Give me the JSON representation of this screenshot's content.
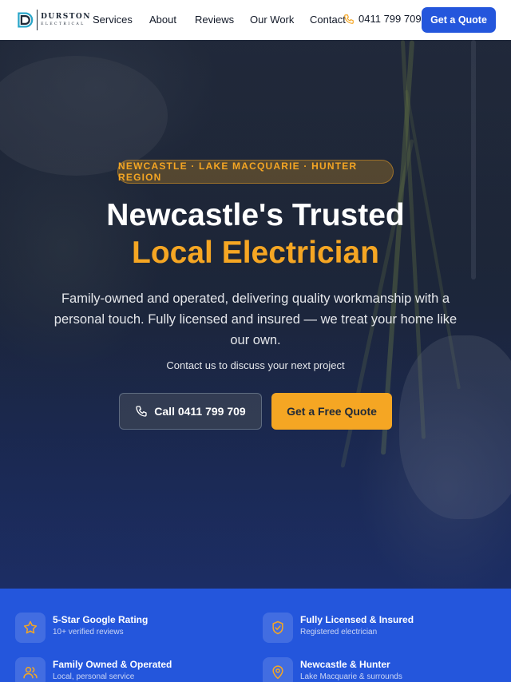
{
  "brand": {
    "name": "DURSTON",
    "tagline": "ELECTRICAL"
  },
  "nav": {
    "links": [
      "Services",
      "About",
      "Reviews",
      "Our Work",
      "Contact"
    ],
    "phone": "0411 799 709",
    "cta_label": "Get a Quote"
  },
  "hero": {
    "badge": "NEWCASTLE · LAKE MACQUARIE · HUNTER REGION",
    "title_line1": "Newcastle's Trusted",
    "title_line2": "Local Electrician",
    "description": "Family-owned and operated, delivering quality workmanship with a personal touch. Fully licensed and insured — we treat your home like our own.",
    "subtext": "Contact us to discuss your next project",
    "call_button": "Call 0411 799 709",
    "quote_button": "Get a Free Quote"
  },
  "features": [
    {
      "title": "5-Star Google Rating",
      "subtitle": "10+ verified reviews",
      "icon": "star-icon"
    },
    {
      "title": "Fully Licensed & Insured",
      "subtitle": "Registered electrician",
      "icon": "shield-check-icon"
    },
    {
      "title": "Family Owned & Operated",
      "subtitle": "Local, personal service",
      "icon": "users-icon"
    },
    {
      "title": "Newcastle & Hunter",
      "subtitle": "Lake Macquarie & surrounds",
      "icon": "map-pin-icon"
    }
  ],
  "colors": {
    "primary": "#2456dc",
    "accent": "#f5a623",
    "nav_bg": "#ffffff"
  }
}
